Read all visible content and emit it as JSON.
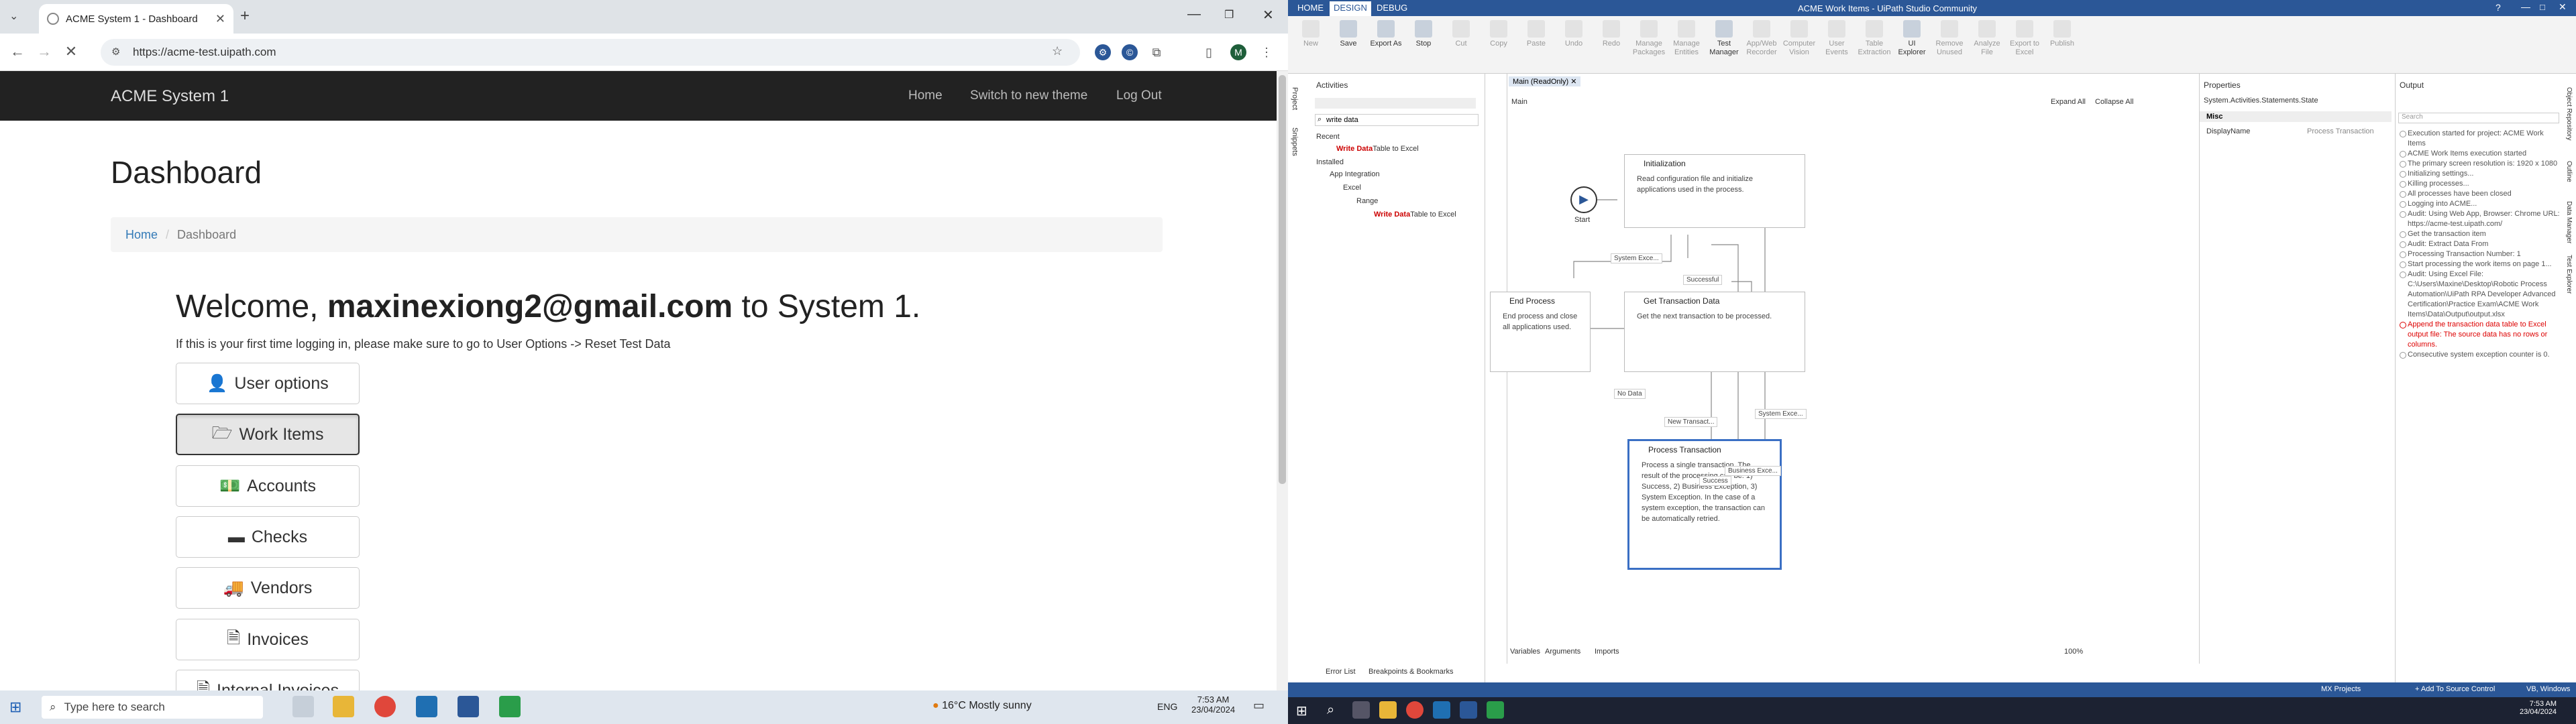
{
  "browser": {
    "tab_title": "ACME System 1 - Dashboard",
    "new_tab": "+",
    "url": "https://acme-test.uipath.com",
    "profile": "M"
  },
  "site": {
    "brand": "ACME System 1",
    "nav": [
      "Home",
      "Switch to new theme",
      "Log Out"
    ],
    "heading": "Dashboard",
    "breadcrumb": {
      "home": "Home",
      "sep": "/",
      "current": "Dashboard"
    },
    "welcome_prefix": "Welcome, ",
    "welcome_user": "maxinexiong2@gmail.com",
    "welcome_suffix": " to System 1.",
    "hint": "If this is your first time logging in, please make sure to go to User Options -> Reset Test Data",
    "buttons": [
      {
        "icon": "user-icon",
        "label": "User options"
      },
      {
        "icon": "folder-open-icon",
        "label": "Work Items"
      },
      {
        "icon": "money-icon",
        "label": "Accounts"
      },
      {
        "icon": "credit-card-icon",
        "label": "Checks"
      },
      {
        "icon": "truck-icon",
        "label": "Vendors"
      },
      {
        "icon": "file-icon",
        "label": "Invoices"
      },
      {
        "icon": "file-icon",
        "label": "Internal Invoices"
      }
    ]
  },
  "taskbar_left": {
    "search_placeholder": "Type here to search",
    "weather": "16°C  Mostly sunny",
    "lang": "ENG",
    "time": "7:53 AM",
    "date": "23/04/2024"
  },
  "uipath": {
    "window_title": "ACME Work Items - UiPath Studio Community",
    "ribbon_tabs": [
      "HOME",
      "DESIGN",
      "DEBUG"
    ],
    "ribbon_buttons": [
      {
        "label": "New",
        "dim": true
      },
      {
        "label": "Save",
        "dim": false
      },
      {
        "label": "Export As",
        "dim": false
      },
      {
        "label": "Stop",
        "dim": false
      },
      {
        "label": "Cut",
        "dim": true
      },
      {
        "label": "Copy",
        "dim": true
      },
      {
        "label": "Paste",
        "dim": true
      },
      {
        "label": "Undo",
        "dim": true
      },
      {
        "label": "Redo",
        "dim": true
      },
      {
        "label": "Manage Packages",
        "dim": true
      },
      {
        "label": "Manage Entities",
        "dim": true
      },
      {
        "label": "Test Manager",
        "dim": false
      },
      {
        "label": "App/Web Recorder",
        "dim": true
      },
      {
        "label": "Computer Vision",
        "dim": true
      },
      {
        "label": "User Events",
        "dim": true
      },
      {
        "label": "Table Extraction",
        "dim": true
      },
      {
        "label": "UI Explorer",
        "dim": false
      },
      {
        "label": "Remove Unused",
        "dim": true
      },
      {
        "label": "Analyze File",
        "dim": true
      },
      {
        "label": "Export to Excel",
        "dim": true
      },
      {
        "label": "Publish",
        "dim": true
      }
    ],
    "activities": {
      "title": "Activities",
      "search": "write data",
      "recent": "Recent",
      "recent_item_bold": "Write Data",
      "recent_item_rest": "Table to Excel",
      "installed": "Installed",
      "app_integration": "App Integration",
      "excel": "Excel",
      "range": "Range",
      "range_item_bold": "Write Data",
      "range_item_rest": "Table to Excel"
    },
    "designer": {
      "tab": "Main (ReadOnly)",
      "breadcrumb": "Main",
      "expand_all": "Expand All",
      "collapse_all": "Collapse All",
      "start": "Start",
      "nodes": [
        {
          "id": "init",
          "title": "Initialization",
          "desc": "Read configuration file and initialize applications used in the process."
        },
        {
          "id": "end",
          "title": "End Process",
          "desc": "End process and close all applications used."
        },
        {
          "id": "get",
          "title": "Get Transaction Data",
          "desc": "Get the next transaction to be processed."
        },
        {
          "id": "proc",
          "title": "Process Transaction",
          "desc": "Process a single transaction. The result of the processing can be: 1) Success, 2) Business Exception, 3) System Exception. In the case of a system exception, the transaction can be automatically retried."
        }
      ],
      "edge_labels": {
        "sys_exc1": "System Exce...",
        "successful": "Successful",
        "no_data": "No Data",
        "new_trans": "New Transact...",
        "sys_exc2": "System Exce...",
        "bus_exc": "Business Exce...",
        "success": "Success"
      },
      "bottom_tabs": [
        "Variables",
        "Arguments",
        "Imports"
      ],
      "zoom": "100%"
    },
    "properties": {
      "title": "Properties",
      "type": "System.Activities.Statements.State",
      "section": "Misc",
      "field": "DisplayName",
      "value": "Process Transaction"
    },
    "output": {
      "title": "Output",
      "search": "Search",
      "lines": [
        {
          "text": "Execution started for project: ACME Work Items",
          "err": false
        },
        {
          "text": "ACME Work Items execution started",
          "err": false
        },
        {
          "text": "The primary screen resolution is: 1920 x 1080",
          "err": false
        },
        {
          "text": "Initializing settings...",
          "err": false
        },
        {
          "text": "Killing processes...",
          "err": false
        },
        {
          "text": "All processes have been closed",
          "err": false
        },
        {
          "text": "Logging into ACME...",
          "err": false
        },
        {
          "text": "Audit: Using Web App, Browser: Chrome URL: https://acme-test.uipath.com/",
          "err": false
        },
        {
          "text": "Get the transaction item",
          "err": false
        },
        {
          "text": "Audit: Extract Data From",
          "err": false
        },
        {
          "text": "Processing Transaction Number: 1",
          "err": false
        },
        {
          "text": "Start processing the work items on page 1...",
          "err": false
        },
        {
          "text": "Audit: Using Excel File: C:\\Users\\Maxine\\Desktop\\Robotic Process Automation\\UiPath RPA Developer Advanced Certification\\Practice Exam\\ACME Work Items\\Data\\Output\\output.xlsx",
          "err": false
        },
        {
          "text": "Append the transaction data table to Excel output file: The source data has no rows or columns.",
          "err": true
        },
        {
          "text": "Consecutive system exception counter is 0.",
          "err": false
        }
      ]
    },
    "bottom_panel_tabs": [
      "Error List",
      "Breakpoints & Bookmarks"
    ],
    "status_bar": {
      "projects": "MX Projects",
      "source_control": "+ Add To Source Control",
      "mode": "VB, Windows"
    },
    "side_tabs_left": [
      "Project",
      "Snippets"
    ],
    "side_tabs_right": [
      "Object Repository",
      "Outline",
      "Data Manager",
      "Test Explorer"
    ]
  },
  "taskbar_right": {
    "time": "7:53 AM",
    "date": "23/04/2024"
  }
}
